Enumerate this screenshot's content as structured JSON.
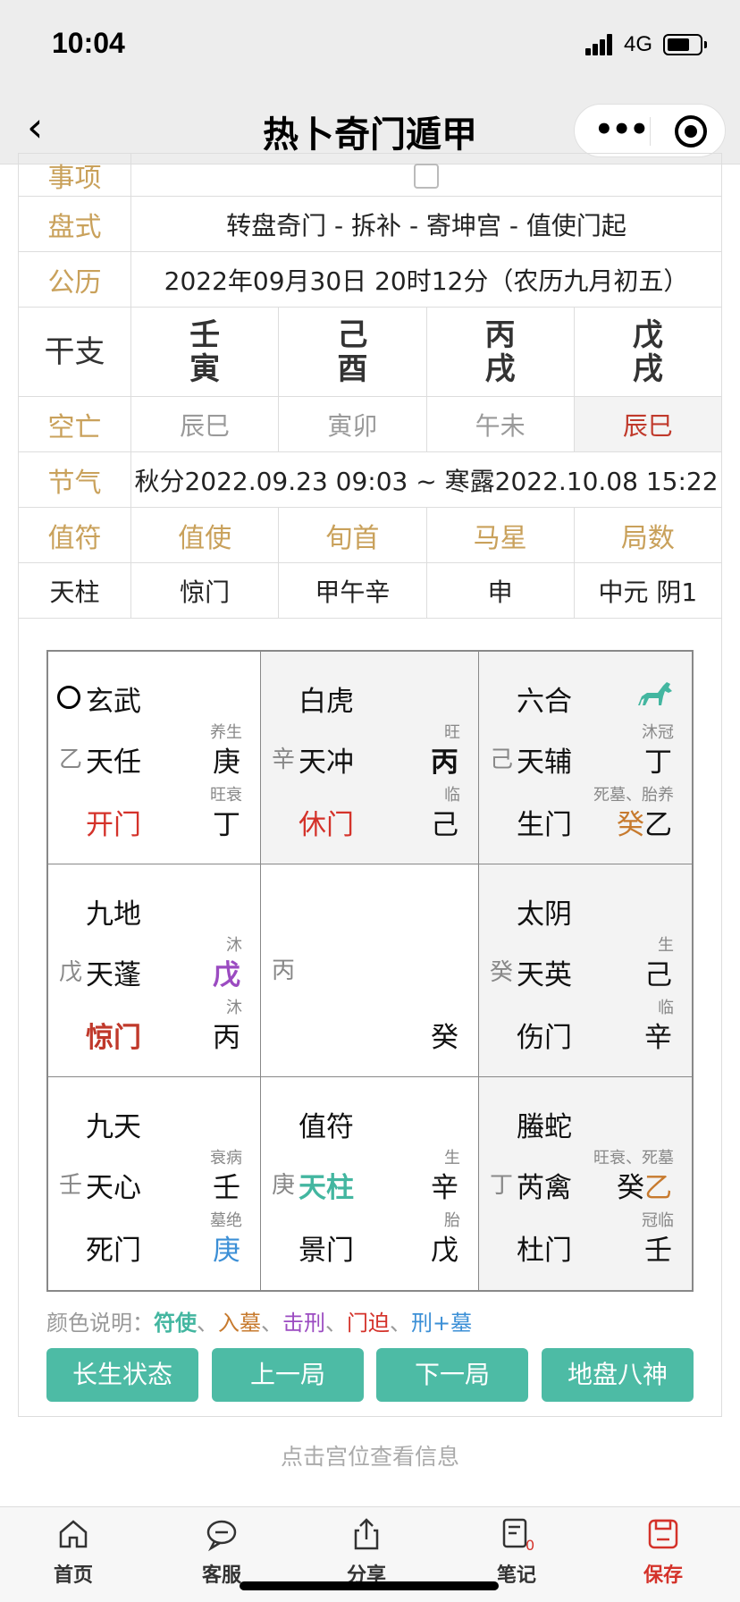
{
  "status": {
    "time": "10:04",
    "network": "4G"
  },
  "nav": {
    "back": "‹",
    "title": "热卜奇门遁甲",
    "more": "•••"
  },
  "info": {
    "row0_label": "事项",
    "row1_label": "盘式",
    "row1_value": "转盘奇门 - 拆补 - 寄坤宫 - 值使门起",
    "row2_label": "公历",
    "row2_value": "2022年09月30日 20时12分（农历九月初五）",
    "ganzhi_label": "干支",
    "ganzhi": [
      {
        "top": "壬",
        "bot": "寅"
      },
      {
        "top": "己",
        "bot": "酉"
      },
      {
        "top": "丙",
        "bot": "戌"
      },
      {
        "top": "戊",
        "bot": "戌"
      }
    ],
    "kongwang_label": "空亡",
    "kongwang": [
      "辰巳",
      "寅卯",
      "午未",
      "辰巳"
    ],
    "jieqi_label": "节气",
    "jieqi": "秋分2022.09.23 09:03 ~ 寒露2022.10.08 15:22",
    "headers": [
      "值符",
      "值使",
      "旬首",
      "马星",
      "局数"
    ],
    "values": [
      "天柱",
      "惊门",
      "甲午辛",
      "申",
      "中元 阴1"
    ]
  },
  "palaces": [
    {
      "god": "玄武",
      "pre": "乙",
      "star": "天任",
      "s1": "养生",
      "r1": "庚",
      "s2": "旺衰",
      "r2": "丁",
      "door": "开门"
    },
    {
      "god": "白虎",
      "pre": "辛",
      "star": "天冲",
      "s1": "旺",
      "r1": "丙",
      "s2": "临",
      "r2": "己",
      "door": "休门"
    },
    {
      "god": "六合",
      "pre": "己",
      "star": "天辅",
      "s1": "沐冠",
      "r1": "丁",
      "s2": "死墓、胎养",
      "r2a": "癸",
      "r2b": "乙",
      "door": "生门"
    },
    {
      "god": "九地",
      "pre": "戊",
      "star": "天蓬",
      "s1": "沐",
      "r1": "戊",
      "s2": "沐",
      "r2": "丙",
      "door": "惊门"
    },
    {
      "center_pre": "丙",
      "center_r2": "癸"
    },
    {
      "god": "太阴",
      "pre": "癸",
      "star": "天英",
      "s1": "生",
      "r1": "己",
      "s2": "临",
      "r2": "辛",
      "door": "伤门"
    },
    {
      "god": "九天",
      "pre": "壬",
      "star": "天心",
      "s1": "衰病",
      "r1": "壬",
      "s2": "墓绝",
      "r2": "庚",
      "door": "死门"
    },
    {
      "god": "值符",
      "pre": "庚",
      "star": "天柱",
      "s1": "生",
      "r1": "辛",
      "s2": "胎",
      "r2": "戊",
      "door": "景门"
    },
    {
      "god": "螣蛇",
      "pre": "丁",
      "star": "芮禽",
      "s1": "旺衰、死墓",
      "r1a": "癸",
      "r1b": "乙",
      "s2": "冠临",
      "r2": "壬",
      "door": "杜门"
    }
  ],
  "legend": {
    "prefix": "颜色说明：",
    "items": [
      "符使",
      "入墓",
      "击刑",
      "门迫",
      "刑+墓"
    ],
    "sep": "、"
  },
  "buttons": [
    "长生状态",
    "上一局",
    "下一局",
    "地盘八神"
  ],
  "hint": "点击宫位查看信息",
  "tabs": [
    "首页",
    "客服",
    "分享",
    "笔记",
    "保存"
  ],
  "tab_badge": "0",
  "colors": {
    "teal": "#4dbba5",
    "gold": "#c9a15b",
    "red": "#d4322a"
  }
}
